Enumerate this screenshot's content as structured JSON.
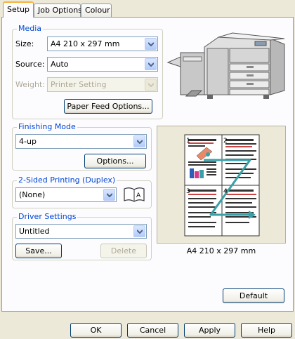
{
  "tabs": [
    {
      "label": "Setup"
    },
    {
      "label": "Job Options"
    },
    {
      "label": "Colour"
    }
  ],
  "media": {
    "legend": "Media",
    "size_label": "Size:",
    "size_value": "A4 210 x 297 mm",
    "source_label": "Source:",
    "source_value": "Auto",
    "weight_label": "Weight:",
    "weight_value": "Printer Setting",
    "paper_feed_button": "Paper Feed Options..."
  },
  "finishing": {
    "legend": "Finishing Mode",
    "value": "4-up",
    "options_button": "Options..."
  },
  "duplex": {
    "legend": "2-Sided Printing (Duplex)",
    "value": "(None)"
  },
  "driver_settings": {
    "legend": "Driver Settings",
    "value": "Untitled",
    "save_button": "Save...",
    "delete_button": "Delete"
  },
  "preview": {
    "caption": "A4 210 x 297 mm",
    "page_numbers": [
      "1",
      "2",
      "3",
      "4"
    ]
  },
  "default_button": "Default",
  "footer": {
    "ok": "OK",
    "cancel": "Cancel",
    "apply": "Apply",
    "help": "Help"
  },
  "colors": {
    "accent_tab": "#f9b23b",
    "legend_text": "#0046d5",
    "preview_arrow": "#3aa0a8"
  }
}
